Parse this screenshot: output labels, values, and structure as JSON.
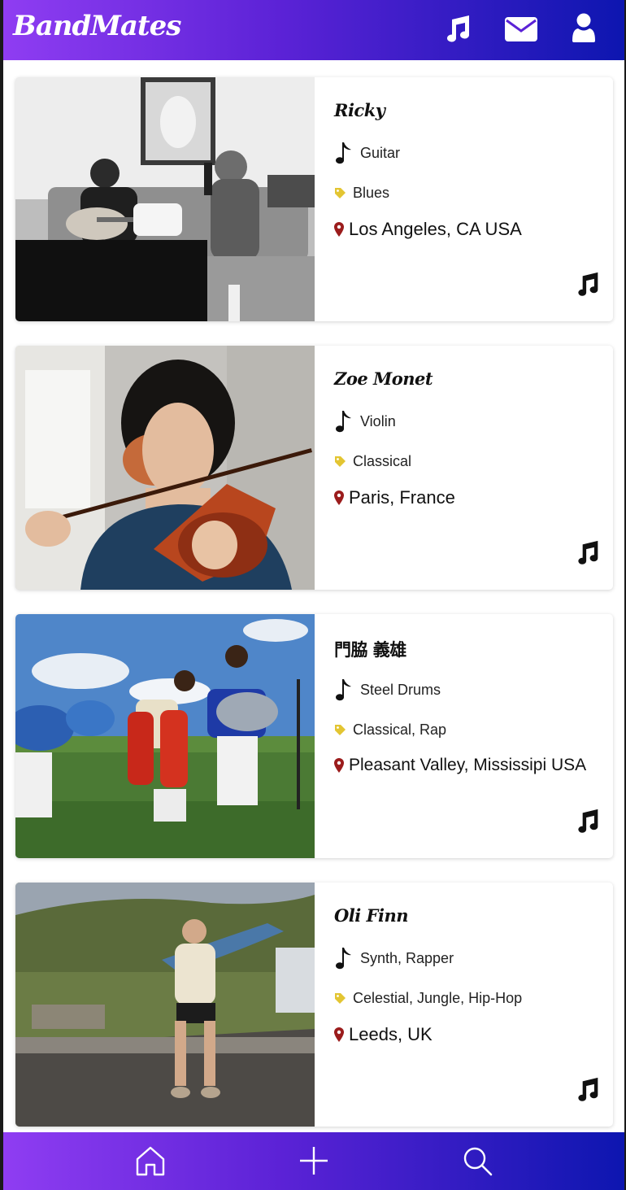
{
  "app": {
    "title": "BandMates"
  },
  "header_icons": [
    "music-icon",
    "envelope-icon",
    "user-icon"
  ],
  "musicians": [
    {
      "name": "Ricky",
      "instrument": "Guitar",
      "genre": "Blues",
      "location": "Los Angeles, CA USA"
    },
    {
      "name": "Zoe Monet",
      "instrument": "Violin",
      "genre": "Classical",
      "location": "Paris, France"
    },
    {
      "name": "門脇 義雄",
      "instrument": "Steel Drums",
      "genre": "Classical, Rap",
      "location": "Pleasant Valley, Mississipi USA"
    },
    {
      "name": "Oli Finn",
      "instrument": "Synth, Rapper",
      "genre": "Celestial, Jungle, Hip-Hop",
      "location": "Leeds, UK"
    }
  ],
  "bottom_nav": [
    "home-icon",
    "plus-icon",
    "search-icon"
  ],
  "colors": {
    "gradient_start": "#8f3df2",
    "gradient_end": "#0d16b0",
    "tag": "#e3c532",
    "location_pin": "#9b1c1c"
  }
}
